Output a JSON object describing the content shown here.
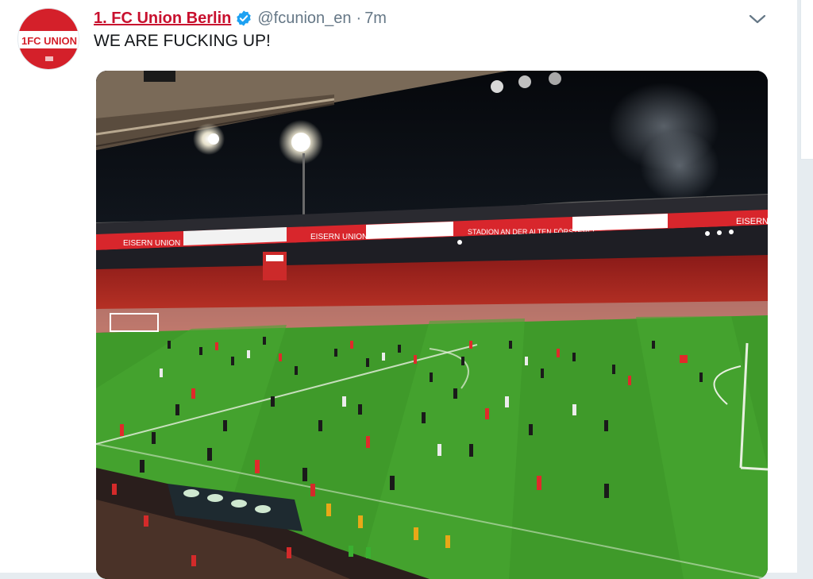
{
  "tweet": {
    "display_name": "1. FC Union Berlin",
    "handle": "@fcunion_en",
    "separator": "·",
    "time": "7m",
    "text": "WE ARE FUCKING UP!",
    "verified": true,
    "avatar_icon": "fc-union-berlin-crest-icon",
    "menu_icon": "chevron-down-icon"
  },
  "media": {
    "description_icon": "stadium-celebration-photo",
    "banner_texts": [
      "EISERN UNION",
      "EISERN UNION",
      "STADION AN DER ALTEN FÖRSTEREI",
      "EISERN"
    ]
  },
  "colors": {
    "brand_red": "#c8102e",
    "verified_blue": "#1da1f2",
    "meta_gray": "#657786",
    "pitch_green": "#3f9a2a"
  }
}
